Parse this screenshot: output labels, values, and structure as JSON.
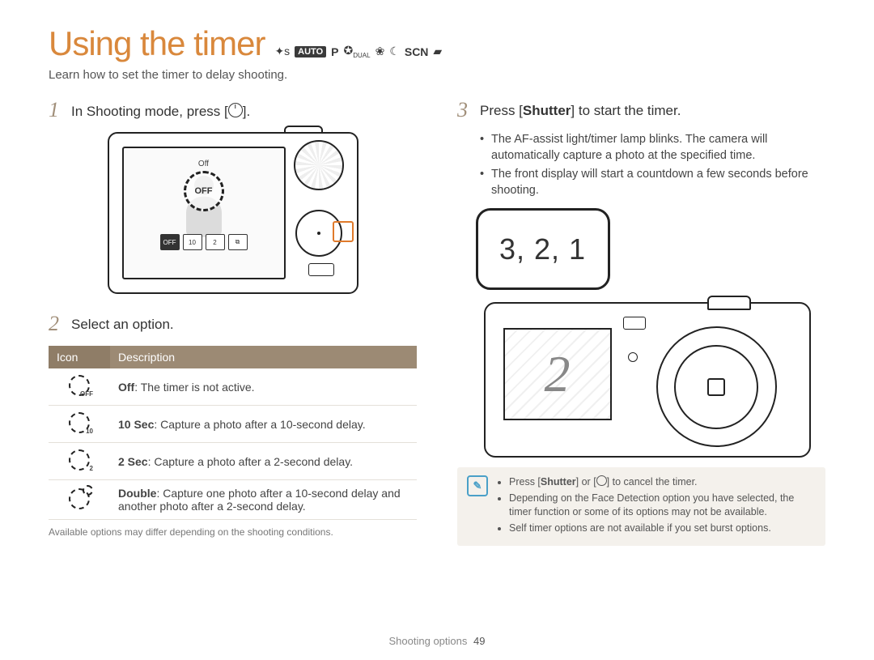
{
  "title": "Using the timer",
  "mode_icons": [
    "S",
    "AUTO",
    "P",
    "DUAL",
    "beauty",
    "night",
    "SCN",
    "movie"
  ],
  "subtitle": "Learn how to set the timer to delay shooting.",
  "steps": {
    "s1": {
      "num": "1",
      "pre": "In Shooting mode, press [",
      "post": "]."
    },
    "s2": {
      "num": "2",
      "text": "Select an option."
    },
    "s3": {
      "num": "3",
      "pre": "Press [",
      "btn": "Shutter",
      "post": "] to start the timer."
    }
  },
  "camera_back": {
    "off_small": "Off",
    "off_big": "OFF",
    "strip": [
      "OFF",
      "10",
      "2",
      "⧉"
    ]
  },
  "step3_bullets": [
    "The AF-assist light/timer lamp blinks. The camera will automatically capture a photo at the specified time.",
    "The front display will start a countdown a few seconds before shooting."
  ],
  "bubble_text": "3, 2, 1",
  "front_lcd_num": "2",
  "table": {
    "h1": "Icon",
    "h2": "Description",
    "rows": [
      {
        "sub": "OFF",
        "label": "Off",
        "desc": ": The timer is not active."
      },
      {
        "sub": "10",
        "label": "10 Sec",
        "desc": ": Capture a photo after a 10-second delay."
      },
      {
        "sub": "2",
        "label": "2 Sec",
        "desc": ": Capture a photo after a 2-second delay."
      },
      {
        "sub": "double",
        "label": "Double",
        "desc": ": Capture one photo after a 10-second delay and another photo after a 2-second delay."
      }
    ]
  },
  "footnote": "Available options may differ depending on the shooting conditions.",
  "note": {
    "items": [
      {
        "pre": "Press [",
        "btn": "Shutter",
        "mid": "] or [",
        "post": "] to cancel the timer."
      },
      {
        "text": "Depending on the Face Detection option you have selected, the timer function or some of its options may not be available."
      },
      {
        "text": "Self timer options are not available if you set burst options."
      }
    ]
  },
  "footer": {
    "section": "Shooting options",
    "page": "49"
  }
}
